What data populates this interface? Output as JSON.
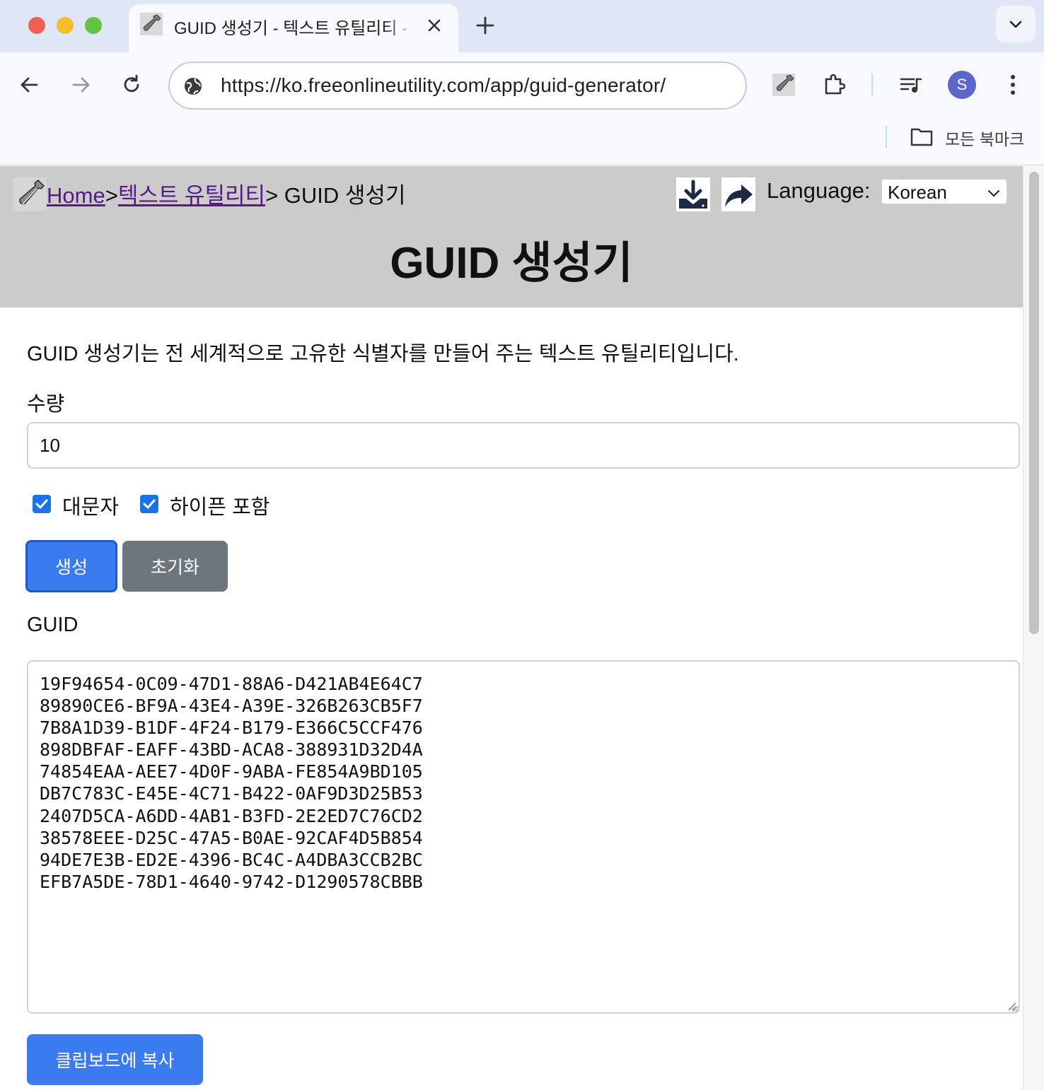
{
  "browser": {
    "tab_title": "GUID 생성기 - 텍스트 유틸리티 - 무료 온라인 유틸리티",
    "url": "https://ko.freeonlineutility.com/app/guid-generator/",
    "avatar_letter": "S",
    "bookmarks_label": "모든 북마크"
  },
  "header": {
    "breadcrumb": {
      "home": "Home",
      "sep1": ">",
      "category": "텍스트 유틸리티",
      "sep2": ">",
      "current": " GUID 생성기"
    },
    "language_label": "Language:",
    "language_value": "Korean",
    "title": "GUID 생성기"
  },
  "main": {
    "description": "GUID 생성기는 전 세계적으로 고유한 식별자를 만들어 주는 텍스트 유틸리티입니다.",
    "quantity_label": "수량",
    "quantity_value": "10",
    "uppercase_label": "대문자",
    "uppercase_checked": true,
    "hyphen_label": "하이픈 포함",
    "hyphen_checked": true,
    "generate_button": "생성",
    "reset_button": "초기화",
    "output_label": "GUID",
    "guids": [
      "19F94654-0C09-47D1-88A6-D421AB4E64C7",
      "89890CE6-BF9A-43E4-A39E-326B263CB5F7",
      "7B8A1D39-B1DF-4F24-B179-E366C5CCF476",
      "898DBFAF-EAFF-43BD-ACA8-388931D32D4A",
      "74854EAA-AEE7-4D0F-9ABA-FE854A9BD105",
      "DB7C783C-E45E-4C71-B422-0AF9D3D25B53",
      "2407D5CA-A6DD-4AB1-B3FD-2E2ED7C76CD2",
      "38578EEE-D25C-47A5-B0AE-92CAF4D5B854",
      "94DE7E3B-ED2E-4396-BC4C-A4DBA3CCB2BC",
      "EFB7A5DE-78D1-4640-9742-D1290578CBBB"
    ],
    "copy_button": "클립보드에 복사"
  },
  "colors": {
    "primary": "#3b7bf0",
    "secondary": "#6d757d",
    "header_bg": "#cbcbcb",
    "link": "#551a8b"
  }
}
